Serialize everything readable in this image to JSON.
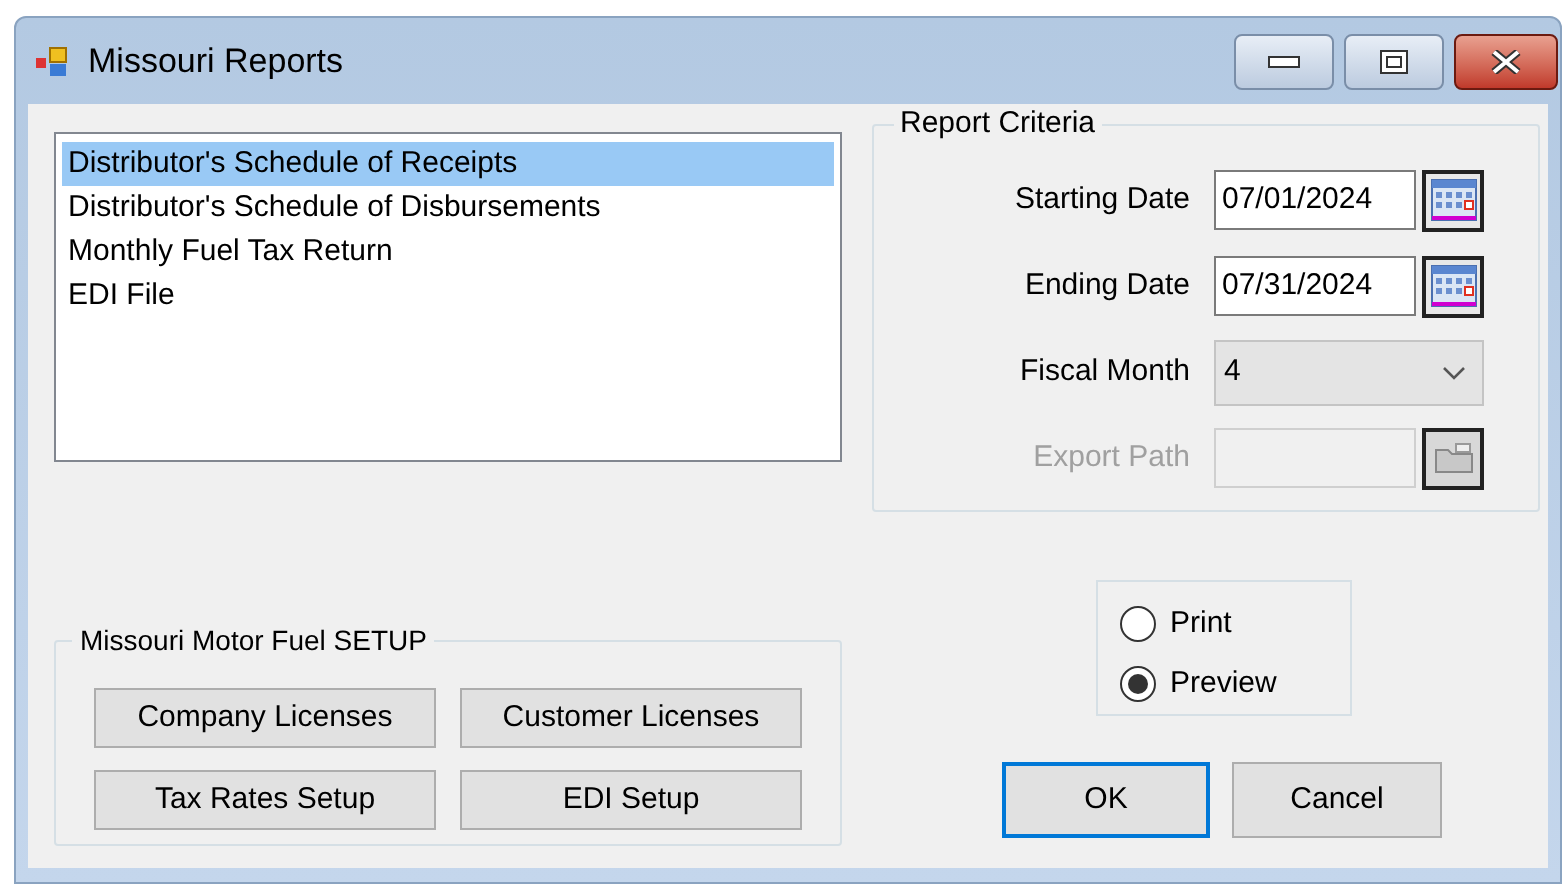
{
  "window": {
    "title": "Missouri Reports"
  },
  "reports": [
    {
      "label": "Distributor's Schedule of Receipts",
      "selected": true
    },
    {
      "label": "Distributor's Schedule of Disbursements",
      "selected": false
    },
    {
      "label": "Monthly Fuel Tax Return",
      "selected": false
    },
    {
      "label": "EDI File",
      "selected": false
    }
  ],
  "report_criteria": {
    "title": "Report Criteria",
    "fields": [
      {
        "kind": "date",
        "label": "Starting Date",
        "value": "07/01/2024",
        "disabled": false
      },
      {
        "kind": "date",
        "label": "Ending Date",
        "value": "07/31/2024",
        "disabled": false
      },
      {
        "kind": "combo",
        "label": "Fiscal Month",
        "value": "4",
        "disabled": false
      },
      {
        "kind": "path",
        "label": "Export Path",
        "disabled": true
      }
    ]
  },
  "setup": {
    "title": "Missouri Motor Fuel SETUP",
    "buttons": [
      "Company Licenses",
      "Customer Licenses",
      "Tax Rates Setup",
      "EDI Setup"
    ]
  },
  "output": [
    {
      "label": "Print",
      "selected": false
    },
    {
      "label": "Preview",
      "selected": true
    }
  ],
  "buttons": [
    {
      "label": "OK",
      "default": true
    },
    {
      "label": "Cancel",
      "default": false
    }
  ]
}
